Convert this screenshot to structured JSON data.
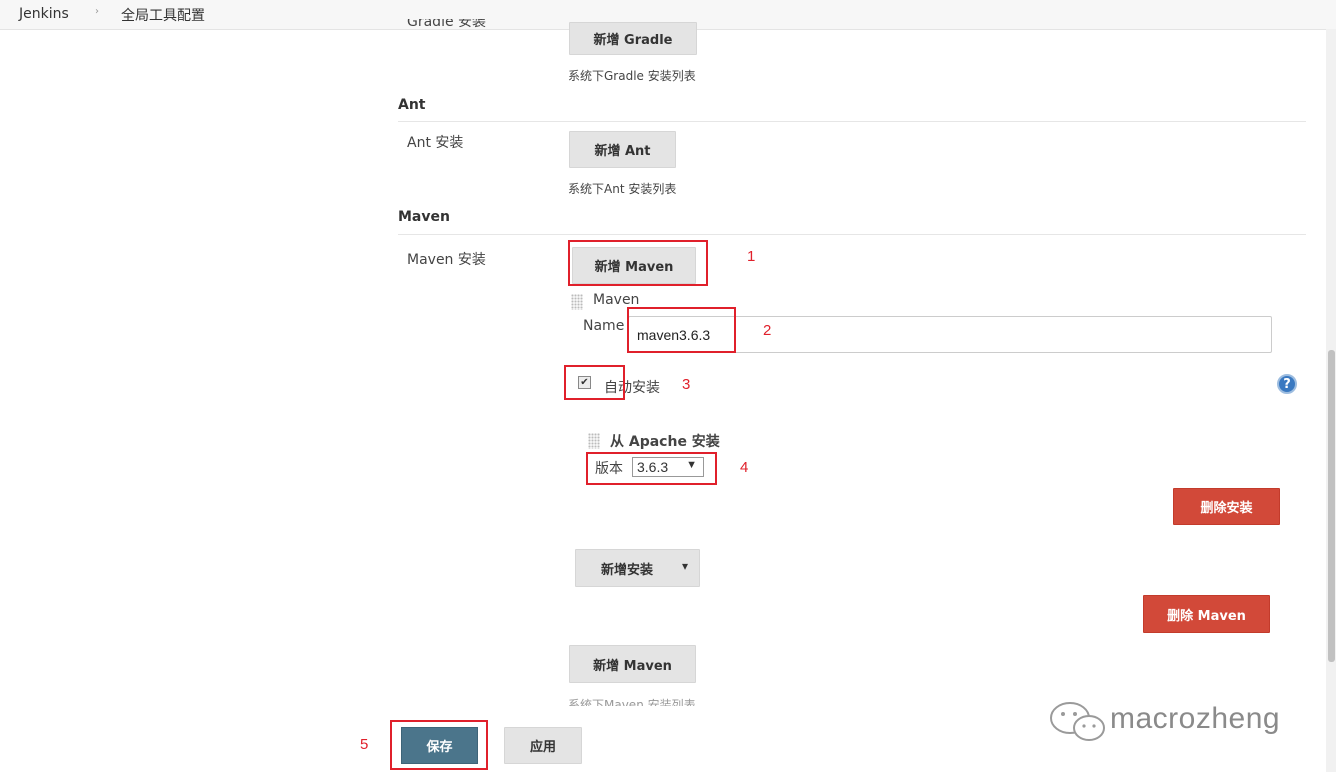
{
  "breadcrumb": {
    "home": "Jenkins",
    "separator": "›",
    "current": "全局工具配置"
  },
  "gradle": {
    "label_cut": "Gradle 安装",
    "add_button": "新增 Gradle",
    "description": "系统下Gradle 安装列表"
  },
  "ant": {
    "section_title": "Ant",
    "label": "Ant 安装",
    "add_button": "新增 Ant",
    "description": "系统下Ant 安装列表"
  },
  "maven": {
    "section_title": "Maven",
    "label": "Maven 安装",
    "add_button": "新增 Maven",
    "item_title": "Maven",
    "name_label": "Name",
    "name_value": "maven3.6.3",
    "auto_install_label": "自动安装",
    "auto_install_checked": true,
    "installer_title": "从 Apache 安装",
    "version_label": "版本",
    "version_value": "3.6.3",
    "delete_installer_button": "删除安装",
    "add_installer_button": "新增安装",
    "delete_maven_button": "删除 Maven",
    "add_button_bottom": "新增 Maven",
    "description": "系统下Maven 安装列表"
  },
  "actions": {
    "save": "保存",
    "apply": "应用"
  },
  "annotations": [
    "1",
    "2",
    "3",
    "4",
    "5"
  ],
  "help_icon_symbol": "?",
  "checkbox_symbol": "✔",
  "select_arrow": "▼",
  "dropdown_arrow": "▾",
  "watermark": "macrozheng",
  "colors": {
    "annotation_red": "#e0202b",
    "delete_red": "#d24939",
    "save_blue": "#4b758b",
    "help_blue": "#3a79c1"
  }
}
